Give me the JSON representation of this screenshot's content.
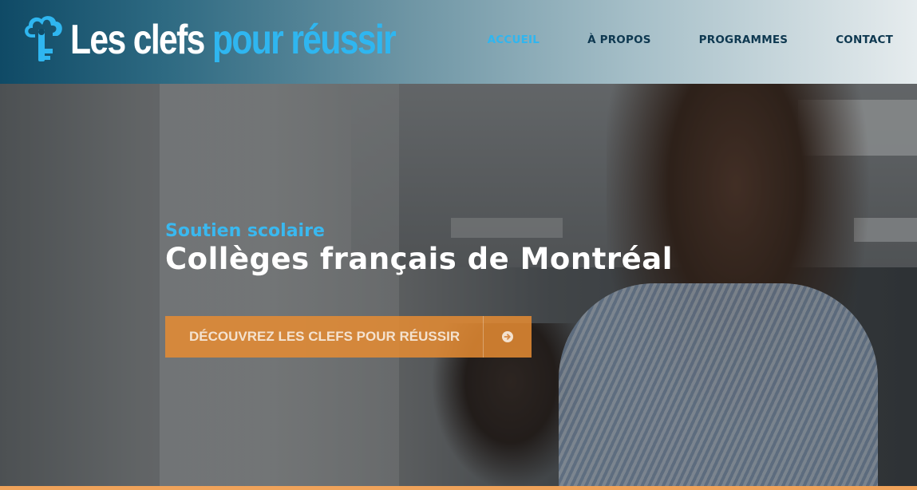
{
  "brand": {
    "logo_word1": "Les clefs",
    "logo_word2": "pour réussir",
    "logo_icon": "cloud-key-icon",
    "colors": {
      "accent": "#2fb6f0",
      "header_dark": "#0f4a66",
      "nav_text": "#0e3850",
      "cta": "#e68c32"
    }
  },
  "nav": {
    "items": [
      {
        "label": "ACCUEIL",
        "active": true
      },
      {
        "label": "À PROPOS",
        "active": false
      },
      {
        "label": "PROGRAMMES",
        "active": false
      },
      {
        "label": "CONTACT",
        "active": false
      }
    ]
  },
  "hero": {
    "subtitle": "Soutien scolaire",
    "title": "Collèges français de Montréal",
    "cta_label": "DÉCOUVREZ LES CLEFS POUR RÉUSSIR",
    "cta_icon": "arrow-circle-right-icon"
  }
}
